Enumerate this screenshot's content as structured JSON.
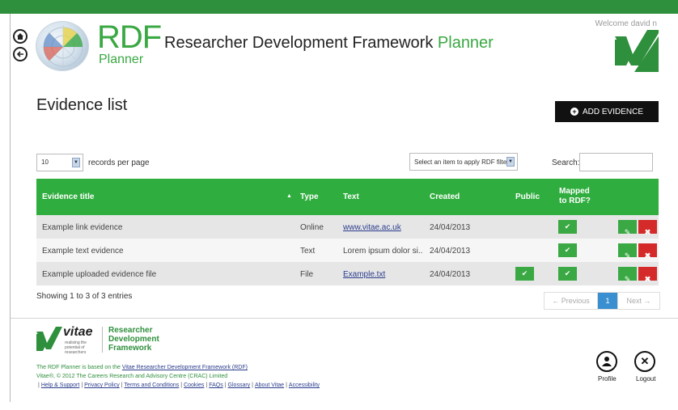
{
  "header": {
    "logo_main": "RDF",
    "logo_sub": "Planner",
    "title_main": "Researcher Development Framework ",
    "title_accent": "Planner",
    "welcome": "Welcome david n"
  },
  "main": {
    "page_title": "Evidence list",
    "add_button_label": "ADD EVIDENCE",
    "records_per_page_value": "10",
    "records_per_page_label": "records per page",
    "rdf_filter_placeholder": "Select an item to apply RDF filter",
    "search_label": "Search:",
    "search_value": ""
  },
  "table": {
    "headers": {
      "title": "Evidence title",
      "sort_indicator": "▲",
      "type": "Type",
      "text": "Text",
      "created": "Created",
      "public": "Public",
      "mapped_line1": "Mapped",
      "mapped_line2": "to RDF?"
    },
    "rows": [
      {
        "title": "Example link evidence",
        "type": "Online",
        "text": "www.vitae.ac.uk",
        "text_is_link": true,
        "created": "24/04/2013",
        "public": false,
        "mapped": true
      },
      {
        "title": "Example text evidence",
        "type": "Text",
        "text": "Lorem ipsum dolor si..",
        "text_is_link": false,
        "created": "24/04/2013",
        "public": false,
        "mapped": true
      },
      {
        "title": "Example uploaded evidence file",
        "type": "File",
        "text": "Example.txt",
        "text_is_link": true,
        "created": "24/04/2013",
        "public": true,
        "mapped": true
      }
    ],
    "info": "Showing 1 to 3 of 3 entries",
    "pagination": {
      "previous": "← Previous",
      "current": "1",
      "next": "Next →"
    }
  },
  "footer": {
    "vitae_word": "vitae",
    "vitae_tagline": "realising the potential of researchers",
    "rdf_line1": "Researcher",
    "rdf_line2": "Development",
    "rdf_line3": "Framework",
    "based_on_prefix": "The RDF Planner is based on the ",
    "based_on_link": "Vitae Researcher Development Framework (RDF)",
    "copyright": "Vitae®, © 2012 The Careers Research and Advisory Centre (CRAC) Limited",
    "links": [
      "Help & Support",
      "Privacy Policy",
      "Terms and Conditions",
      "Cookies",
      "FAQs",
      "Glossary",
      "About Vitae",
      "Accessibility"
    ],
    "profile_label": "Profile",
    "logout_label": "Logout"
  },
  "colors": {
    "brand_green": "#2e8f3c",
    "table_header_green": "#2fad3e",
    "delete_red": "#d42a2a",
    "link_blue": "#2a3c8c",
    "pager_active": "#3a8fd0"
  },
  "icons": [
    "home-icon",
    "back-icon",
    "plus-circle-icon",
    "checkmark-icon",
    "edit-icon",
    "delete-icon",
    "profile-icon",
    "logout-icon"
  ]
}
